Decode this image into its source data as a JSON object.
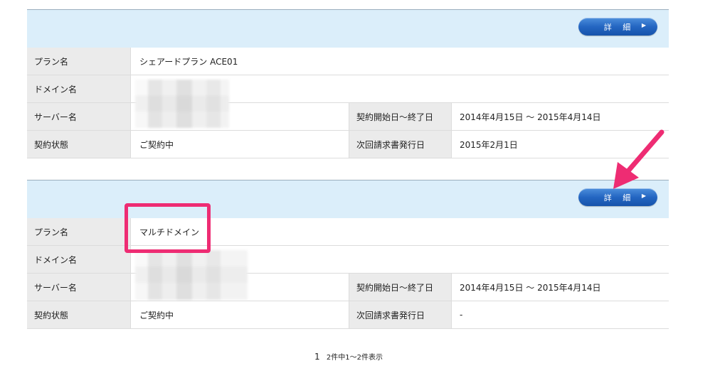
{
  "detail_button": {
    "label": "詳 細",
    "arrow": "▶"
  },
  "contracts": [
    {
      "plan_label": "プラン名",
      "plan_value": "シェアードプラン ACE01",
      "domain_label": "ドメイン名",
      "server_label": "サーバー名",
      "period_label": "契約開始日〜終了日",
      "period_value": "2014年4月15日 〜 2015年4月14日",
      "status_label": "契約状態",
      "status_value": "ご契約中",
      "next_invoice_label": "次回請求書発行日",
      "next_invoice_value": "2015年2月1日"
    },
    {
      "plan_label": "プラン名",
      "plan_value": "マルチドメイン",
      "domain_label": "ドメイン名",
      "server_label": "サーバー名",
      "period_label": "契約開始日〜終了日",
      "period_value": "2014年4月15日 〜 2015年4月14日",
      "status_label": "契約状態",
      "status_value": "ご契約中",
      "next_invoice_label": "次回請求書発行日",
      "next_invoice_value": "-"
    }
  ],
  "pagination": {
    "page": "1",
    "summary": "2件中1〜2件表示"
  },
  "colors": {
    "header_bg": "#dbeefa",
    "button": "#2466c2",
    "highlight": "#ee2c73",
    "label_bg": "#ebebeb"
  }
}
